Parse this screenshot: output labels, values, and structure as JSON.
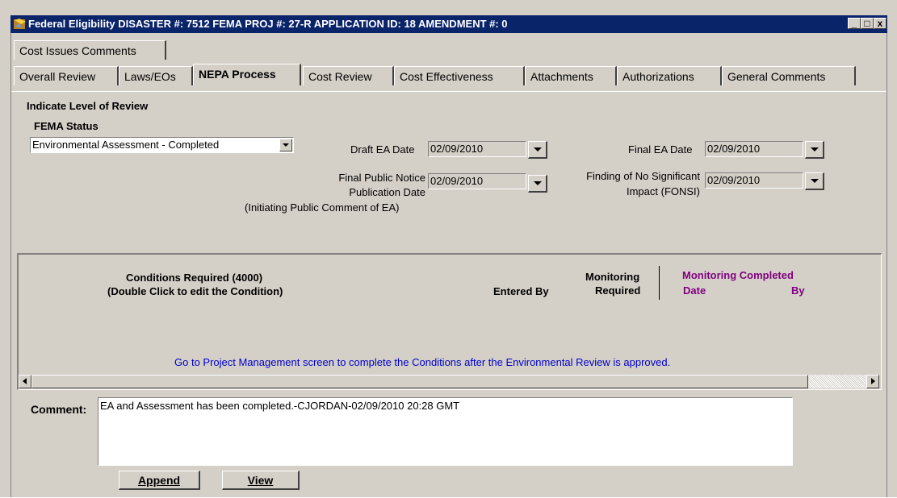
{
  "window": {
    "title": "Federal Eligibility  DISASTER #: 7512   FEMA PROJ #: 27-R   APPLICATION ID: 18   AMENDMENT #: 0",
    "minimize": "_",
    "maximize": "□",
    "close": "x"
  },
  "tabs_row1": [
    {
      "label": "Cost Issues Comments"
    }
  ],
  "tabs_row2": [
    {
      "label": "Overall Review"
    },
    {
      "label": "Laws/EOs"
    },
    {
      "label": "NEPA Process",
      "active": true
    },
    {
      "label": "Cost Review"
    },
    {
      "label": "Cost Effectiveness"
    },
    {
      "label": "Attachments"
    },
    {
      "label": "Authorizations"
    },
    {
      "label": "General Comments"
    }
  ],
  "nepa": {
    "indicate_label": "Indicate Level of Review",
    "fema_status_label": "FEMA Status",
    "fema_status_value": "Environmental Assessment - Completed",
    "draft_ea_label": "Draft EA Date",
    "draft_ea_value": "02/09/2010",
    "final_ea_label": "Final EA Date",
    "final_ea_value": "02/09/2010",
    "public_notice_label_1": "Final Public Notice",
    "public_notice_label_2": "Publication Date",
    "public_notice_label_3": "(Initiating Public Comment of EA)",
    "public_notice_value": "02/09/2010",
    "fonsi_label_1": "Finding of No Significant",
    "fonsi_label_2": "Impact (FONSI)",
    "fonsi_value": "02/09/2010"
  },
  "conditions": {
    "title_1": "Conditions Required (4000)",
    "title_2": "(Double Click to edit the Condition)",
    "entered_by": "Entered By",
    "monitoring_1": "Monitoring",
    "monitoring_2": "Required",
    "monitoring_completed": "Monitoring Completed",
    "date": "Date",
    "by": "By",
    "note": "Go to Project Management screen to complete the Conditions after the Environmental Review is approved."
  },
  "comment": {
    "label": "Comment:",
    "value": "EA and Assessment has been completed.-CJORDAN-02/09/2010 20:28 GMT"
  },
  "buttons": {
    "append": "Append",
    "view": "View"
  }
}
